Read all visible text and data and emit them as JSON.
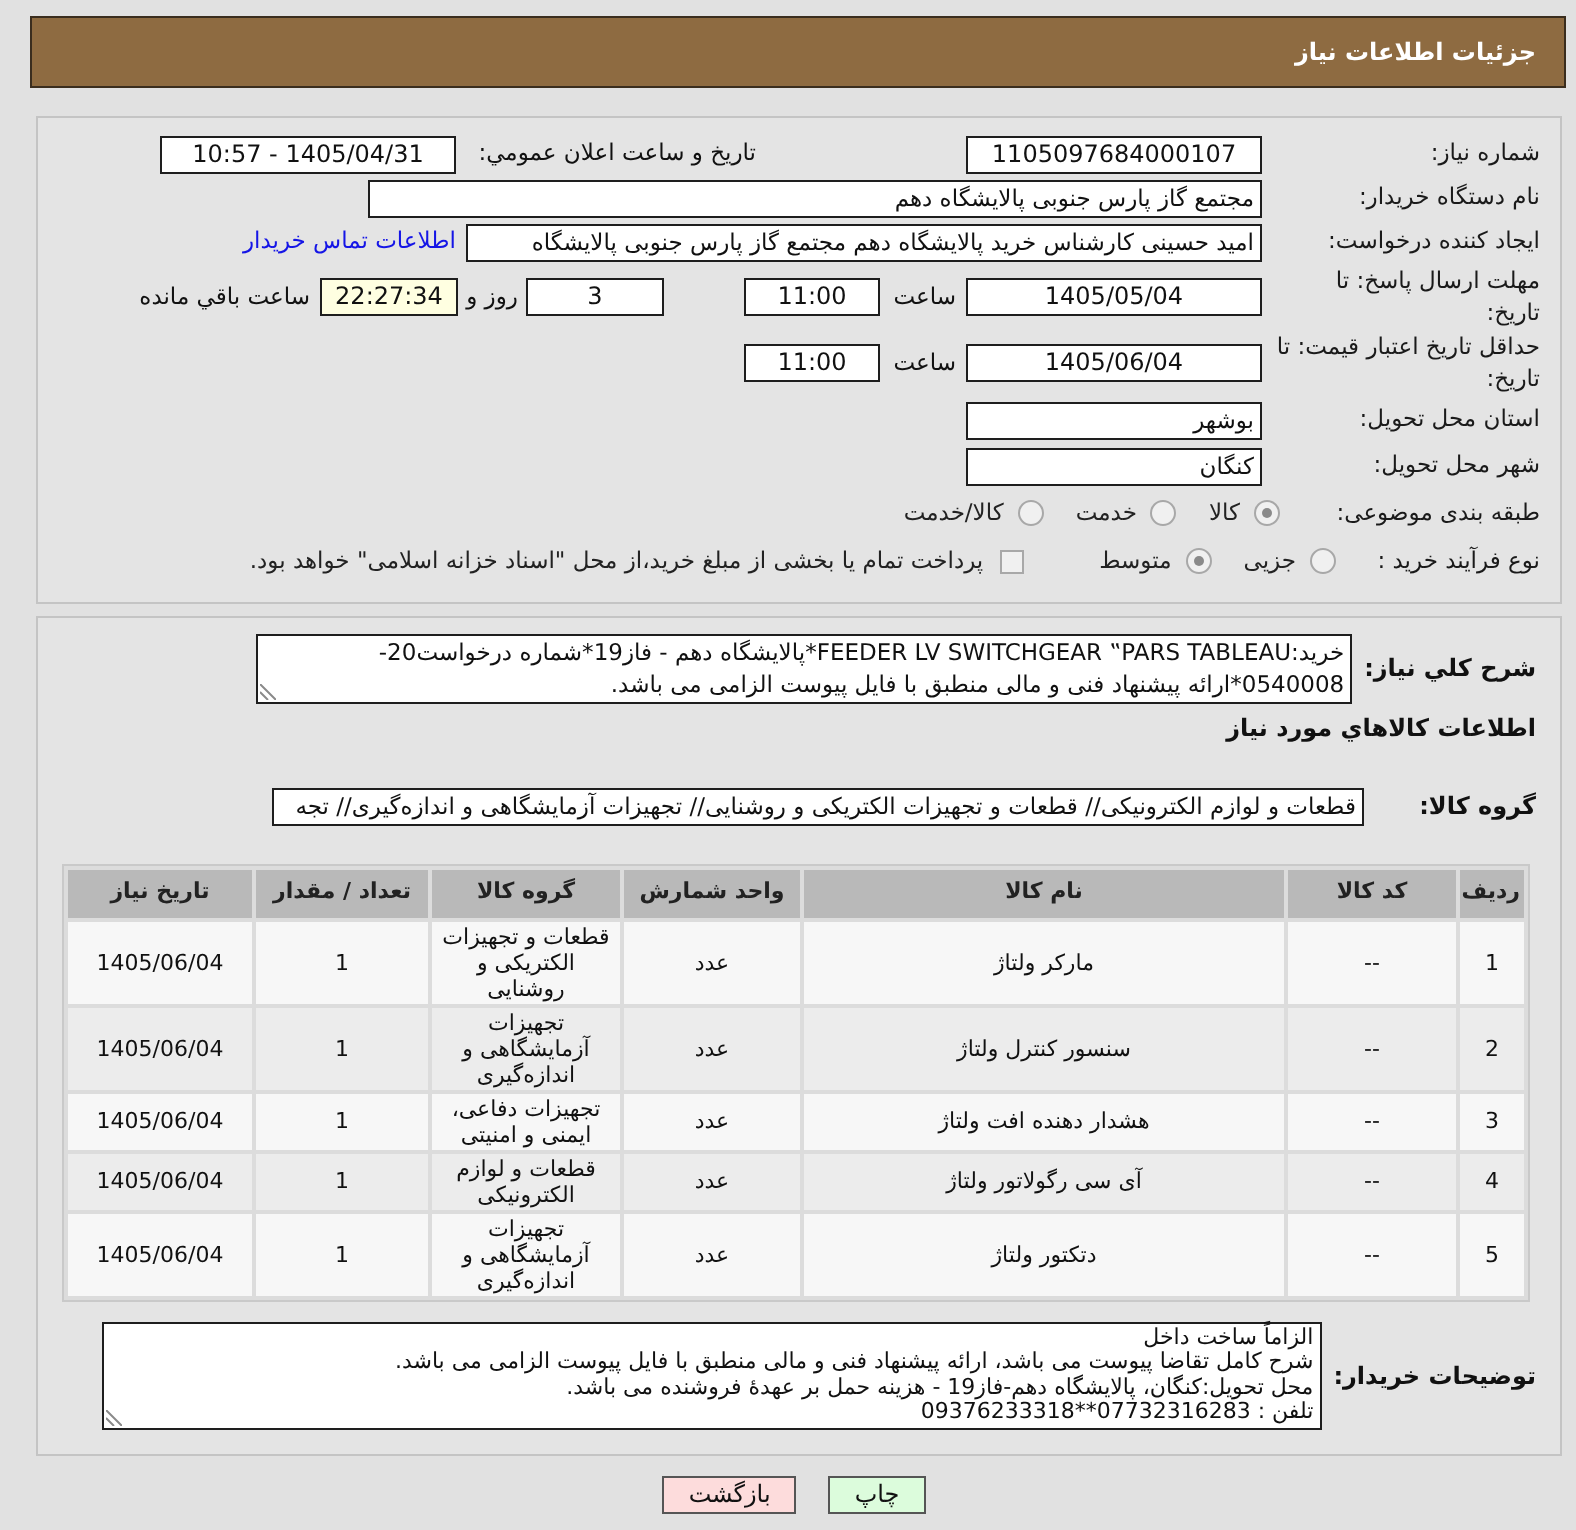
{
  "header": {
    "title": "جزئیات اطلاعات نیاز"
  },
  "details": {
    "need_number": {
      "label": "شماره نیاز:",
      "value": "1105097684000107"
    },
    "announced": {
      "label": "تاریخ و ساعت اعلان عمومي:",
      "value": "1405/04/31 - 10:57"
    },
    "buyer_organization": {
      "label": "نام دستگاه خریدار:",
      "value": "مجتمع گاز پارس جنوبی  پالایشگاه دهم"
    },
    "requester": {
      "label": "ایجاد کننده درخواست:",
      "value": "امید حسینی کارشناس خرید پالایشگاه دهم  مجتمع گاز پارس جنوبی  پالایشگاه",
      "contact_link": "اطلاعات تماس خریدار"
    },
    "response_deadline": {
      "label": "مهلت ارسال پاسخ: تا تاریخ:",
      "date": "1405/05/04",
      "time_label": "ساعت",
      "time": "11:00",
      "days": "3",
      "days_label": "روز و",
      "remaining": "22:27:34",
      "remaining_label": "ساعت باقي مانده"
    },
    "price_validity": {
      "label": "حداقل تاریخ اعتبار قیمت: تا تاریخ:",
      "date": "1405/06/04",
      "time_label": "ساعت",
      "time": "11:00"
    },
    "delivery_province": {
      "label": "استان محل تحویل:",
      "value": "بوشهر"
    },
    "delivery_city": {
      "label": "شهر محل تحویل:",
      "value": "کنگان"
    },
    "subject_category": {
      "label": "طبقه بندی موضوعی:",
      "options": [
        {
          "label": "کالا",
          "selected": true
        },
        {
          "label": "خدمت",
          "selected": false
        },
        {
          "label": "کالا/خدمت",
          "selected": false
        }
      ]
    },
    "purchase_process": {
      "label": "نوع فرآیند خرید :",
      "options": [
        {
          "label": "جزیی",
          "selected": false
        },
        {
          "label": "متوسط",
          "selected": true
        }
      ],
      "treasury_payment": {
        "label": "پرداخت تمام یا بخشی از مبلغ خرید،از محل \"اسناد خزانه اسلامی\" خواهد بود.",
        "checked": false
      }
    }
  },
  "description": {
    "label": "شرح کلي نیاز:",
    "value": "خرید:FEEDER LV SWITCHGEAR ‟PARS TABLEAU*پالایشگاه دهم - فاز19*شماره درخواست20-0540008*ارائه پیشنهاد فنی و مالی منطبق با فایل پیوست الزامی می باشد."
  },
  "items": {
    "title": "اطلاعات کالاهاي مورد نیاز",
    "group_label": "گروه کالا:",
    "group_value": "قطعات و لوازم الکترونیکی// قطعات و تجهیزات الکتریکی و روشنایی// تجهیزات آزمایشگاهی و اندازه‌گیری// تجه",
    "table": {
      "columns": [
        "ردیف",
        "کد کالا",
        "نام کالا",
        "واحد شمارش",
        "گروه کالا",
        "تعداد / مقدار",
        "تاریخ نیاز"
      ],
      "rows": [
        [
          "1",
          "--",
          "مارکر ولتاژ",
          "عدد",
          "قطعات و تجهیزات الکتریکی و روشنایی",
          "1",
          "1405/06/04"
        ],
        [
          "2",
          "--",
          "سنسور کنترل ولتاژ",
          "عدد",
          "تجهیزات آزمایشگاهی و اندازه‌گیری",
          "1",
          "1405/06/04"
        ],
        [
          "3",
          "--",
          "هشدار دهنده افت ولتاژ",
          "عدد",
          "تجهیزات دفاعی، ایمنی و امنیتی",
          "1",
          "1405/06/04"
        ],
        [
          "4",
          "--",
          "آی سی رگولاتور ولتاژ",
          "عدد",
          "قطعات و لوازم الکترونیکی",
          "1",
          "1405/06/04"
        ],
        [
          "5",
          "--",
          "دتکتور ولتاژ",
          "عدد",
          "تجهیزات آزمایشگاهی و اندازه‌گیری",
          "1",
          "1405/06/04"
        ]
      ]
    }
  },
  "buyer_notes": {
    "label": "توضیحات خریدار:",
    "lines": [
      "الزاماً ساخت داخل",
      "شرح کامل تقاضا پیوست می باشد، ارائه پیشنهاد فنی و مالی منطبق با فایل پیوست الزامی می باشد.",
      "محل تحویل:کنگان، پالایشگاه دهم-فاز19 - هزینه حمل بر عهدهٔ فروشنده می باشد.",
      "تلفن : 07732316283**09376233318"
    ]
  },
  "buttons": [
    {
      "label": "چاپ",
      "kind": "print"
    },
    {
      "label": "بازگشت",
      "kind": "back"
    }
  ]
}
